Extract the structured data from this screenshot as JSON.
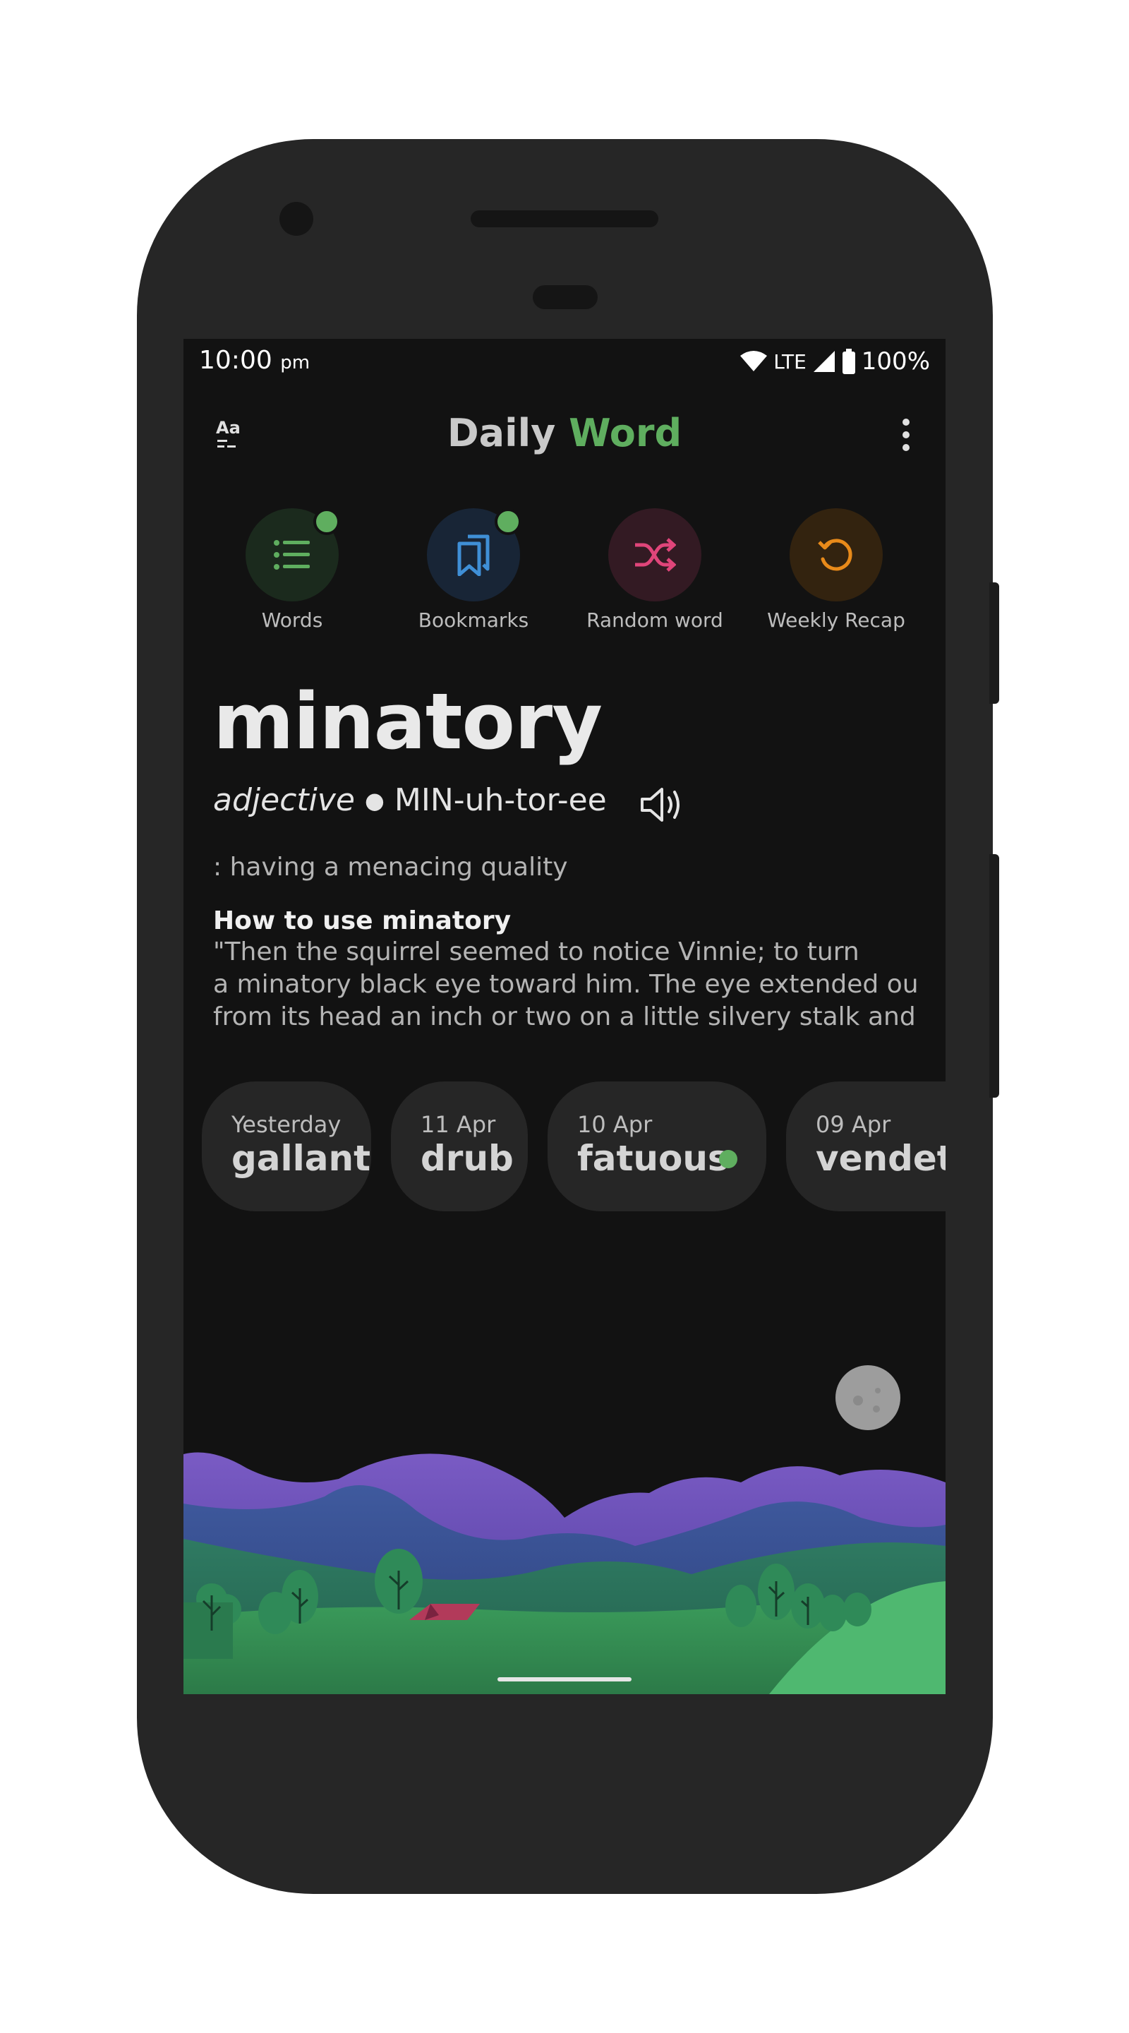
{
  "status_bar": {
    "time": "10:00",
    "period": "pm",
    "network": "LTE",
    "battery": "100%"
  },
  "app_bar": {
    "title_main": "Daily",
    "title_accent": "Word",
    "font_icon": "text-size-icon",
    "menu_icon": "more-vert-icon"
  },
  "shortcuts": [
    {
      "label": "Words",
      "icon": "list-icon",
      "color": "#5fae5f",
      "has_dot": true
    },
    {
      "label": "Bookmarks",
      "icon": "bookmarks-icon",
      "color": "#3f8fd6",
      "has_dot": true
    },
    {
      "label": "Random word",
      "icon": "shuffle-icon",
      "color": "#e0457a",
      "has_dot": false
    },
    {
      "label": "Weekly Recap",
      "icon": "history-icon",
      "color": "#e88a1a",
      "has_dot": false
    }
  ],
  "word": {
    "text": "minatory",
    "part_of_speech": "adjective",
    "pronunciation": "MIN-uh-tor-ee",
    "definition": ": having a menacing quality",
    "usage_heading": "How to use minatory",
    "usage_lines": [
      "\"Then the squirrel seemed to notice Vinnie; to turn",
      "a minatory black eye toward him. The eye extended out",
      "from its head an inch or two on a little silvery stalk and ti..."
    ]
  },
  "history": [
    {
      "date": "Yesterday",
      "word": "gallant",
      "has_dot": false
    },
    {
      "date": "11 Apr",
      "word": "drub",
      "has_dot": false
    },
    {
      "date": "10 Apr",
      "word": "fatuous",
      "has_dot": true
    },
    {
      "date": "09 Apr",
      "word": "vendetta",
      "has_dot": false
    }
  ],
  "colors": {
    "accent_green": "#5fae5f",
    "background": "#121212",
    "card": "#262626",
    "phone_body": "#262626"
  },
  "decor": {
    "moon_icon": "moon-icon",
    "landscape": "landscape-illustration"
  }
}
